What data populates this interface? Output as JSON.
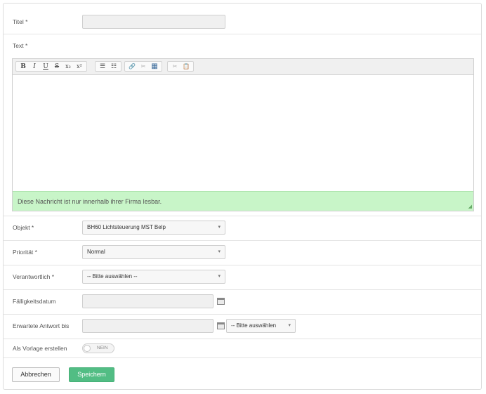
{
  "form": {
    "title_label": "Titel *",
    "text_label": "Text *",
    "object_label": "Objekt *",
    "object_value": "BH60 Lichtsteuerung MST Belp",
    "priority_label": "Priorität *",
    "priority_value": "Normal",
    "responsible_label": "Verantwortlich *",
    "responsible_value": "-- Bitte auswählen --",
    "due_date_label": "Fälligkeitsdatum",
    "expected_answer_label": "Erwartete Antwort bis",
    "expected_answer_select": "-- Bitte auswählen",
    "template_label": "Als Vorlage erstellen",
    "template_toggle": "NEIN"
  },
  "editor": {
    "toolbar": {
      "bold": "B",
      "italic": "I",
      "underline": "U",
      "strike": "S",
      "subscript": "x₂",
      "superscript": "x²",
      "bullet_list": "☰",
      "numbered_list": "☷",
      "link": "🔗",
      "unlink": "✂",
      "table": "▦",
      "cut": "✂",
      "paste": "📋"
    },
    "notice": "Diese Nachricht ist nur innerhalb ihrer Firma lesbar."
  },
  "buttons": {
    "cancel": "Abbrechen",
    "save": "Speichern"
  },
  "colors": {
    "notice_bg": "#c8f5c8",
    "save_bg": "#52bd84"
  }
}
